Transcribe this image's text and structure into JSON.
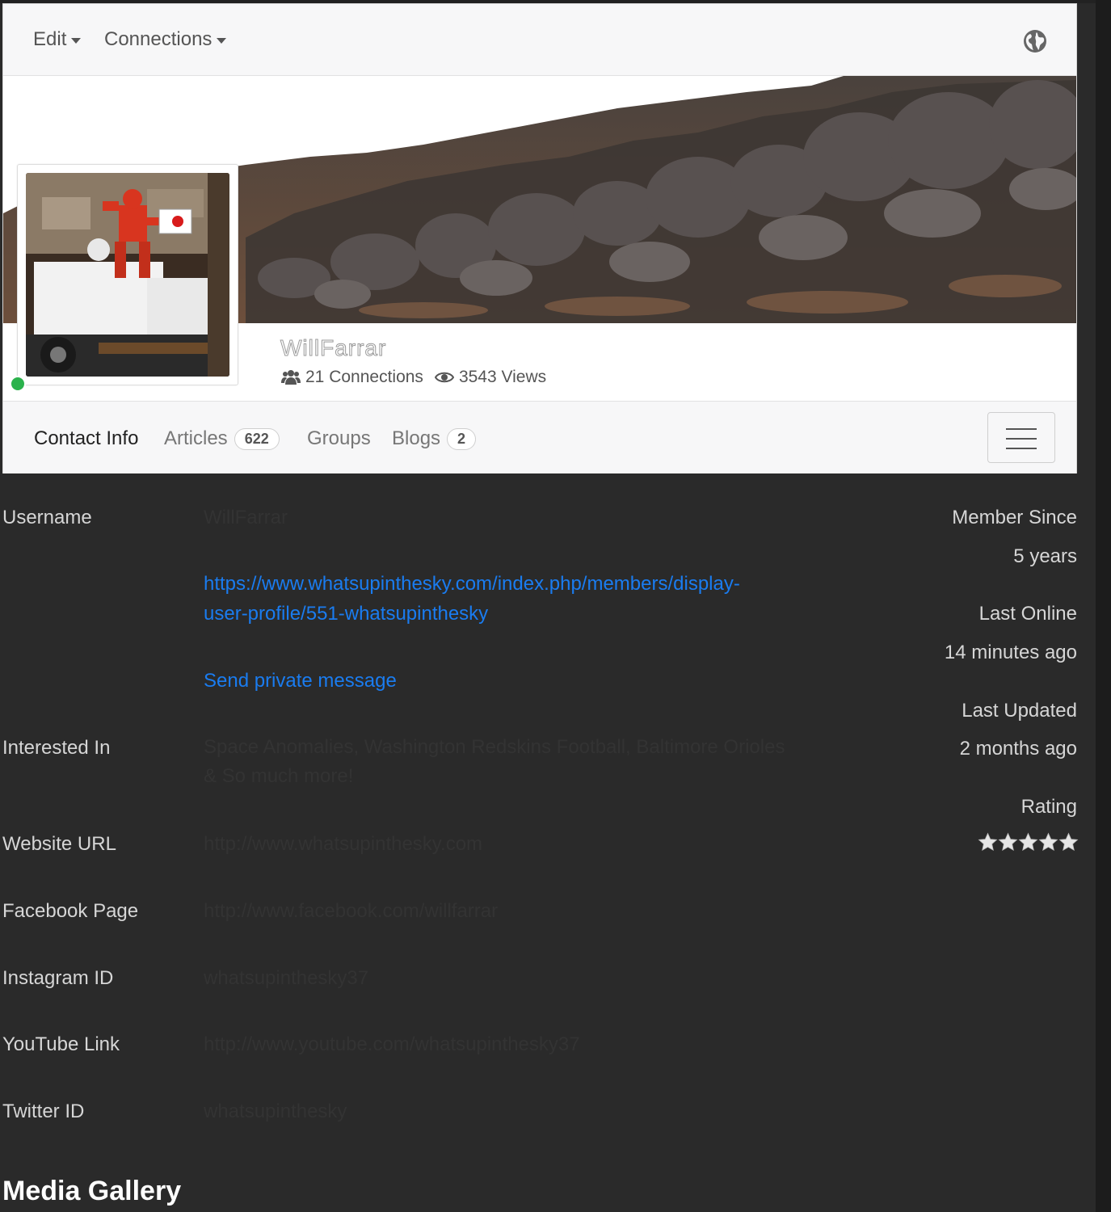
{
  "topbar": {
    "menu": [
      {
        "label": "Edit"
      },
      {
        "label": "Connections"
      }
    ],
    "globe_icon": "globe-icon"
  },
  "profile": {
    "name": "WillFarrar",
    "connections": "21 Connections",
    "views": "3543 Views",
    "online": true
  },
  "tabs": [
    {
      "label": "Contact Info",
      "active": true
    },
    {
      "label": "Articles",
      "badge": "622"
    },
    {
      "label": "Groups"
    },
    {
      "label": "Blogs",
      "badge": "2"
    }
  ],
  "fields": {
    "username": {
      "label": "Username",
      "value": "WillFarrar"
    },
    "profile_link_line1": "https://www.whatsupinthesky.com/index.php/members/display-",
    "profile_link_line2": "user-profile/551-whatsupinthesky",
    "send_message": "Send private message",
    "interested_in": {
      "label": "Interested In",
      "value_line1": "Space Anomalies, Washington Redskins Football, Baltimore Orioles",
      "value_line2": "& So much more!"
    },
    "website": {
      "label": "Website URL",
      "value": "http://www.whatsupinthesky.com"
    },
    "facebook": {
      "label": "Facebook Page",
      "value": "http://www.facebook.com/willfarrar"
    },
    "instagram": {
      "label": "Instagram ID",
      "value": "whatsupinthesky37"
    },
    "youtube": {
      "label": "YouTube Link",
      "value": "http://www.youtube.com/whatsupinthesky37"
    },
    "twitter": {
      "label": "Twitter ID",
      "value": "whatsupinthesky"
    }
  },
  "sidebar": {
    "member_since_label": "Member Since",
    "member_since_value": "5 years",
    "last_online_label": "Last Online",
    "last_online_value": "14 minutes ago",
    "last_updated_label": "Last Updated",
    "last_updated_value": "2 months ago",
    "rating_label": "Rating",
    "rating_stars": 5
  },
  "media_gallery_title": "Media Gallery",
  "colors": {
    "link": "#1a7cf0",
    "online": "#2bb24c",
    "background": "#2a2a2a"
  }
}
